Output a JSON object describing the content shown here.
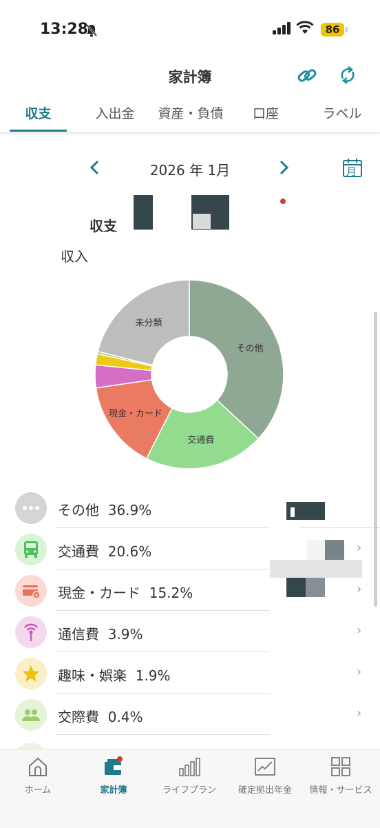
{
  "status_bar": {
    "time": "13:28",
    "battery": "86"
  },
  "header": {
    "title": "家計簿",
    "link_icon": "link-icon",
    "sync_icon": "sync-icon"
  },
  "tabs": [
    {
      "label": "収支",
      "active": true
    },
    {
      "label": "入出金",
      "active": false
    },
    {
      "label": "資産・負債",
      "active": false
    },
    {
      "label": "口座",
      "active": false,
      "badge": true
    },
    {
      "label": "ラベル",
      "active": false
    }
  ],
  "month_nav": {
    "label": "2026 年 1月",
    "calendar_label": "月"
  },
  "summary": {
    "title": "収支",
    "income_label": "収入"
  },
  "chart_data": {
    "type": "pie",
    "slices": [
      {
        "label": "その他",
        "value": 36.9,
        "color": "#8fa893"
      },
      {
        "label": "交通費",
        "value": 20.6,
        "color": "#93db8f"
      },
      {
        "label": "現金・カード",
        "value": 15.2,
        "color": "#ea7b62"
      },
      {
        "label": "",
        "value": 3.9,
        "color": "#d56ec4"
      },
      {
        "label": "",
        "value": 1.9,
        "color": "#efca14"
      },
      {
        "label": "",
        "value": 0.4,
        "color": "#a4cd72"
      },
      {
        "label": "未分類",
        "value": 21.1,
        "color": "#bdbdbd"
      }
    ],
    "donut": true
  },
  "categories": [
    {
      "label": "その他",
      "percent": "36.9%",
      "icon": "more-dots-icon",
      "bg": "#d4d4d4",
      "fg": "#ffffff"
    },
    {
      "label": "交通費",
      "percent": "20.6%",
      "icon": "bus-icon",
      "bg": "#d9f3d5",
      "fg": "#4cbf62"
    },
    {
      "label": "現金・カード",
      "percent": "15.2%",
      "icon": "card-icon",
      "bg": "#fadad2",
      "fg": "#e7705a"
    },
    {
      "label": "通信費",
      "percent": "3.9%",
      "icon": "antenna-icon",
      "bg": "#f4d9ee",
      "fg": "#c45bb3"
    },
    {
      "label": "趣味・娯楽",
      "percent": "1.9%",
      "icon": "star-icon",
      "bg": "#fbefc7",
      "fg": "#eebf0d"
    },
    {
      "label": "交際費",
      "percent": "0.4%",
      "icon": "people-icon",
      "bg": "#e7f3d6",
      "fg": "#9ccb6b"
    }
  ],
  "bottom_nav": [
    {
      "label": "ホーム",
      "icon": "home-icon",
      "active": false
    },
    {
      "label": "家計簿",
      "icon": "wallet-icon",
      "active": true
    },
    {
      "label": "ライフプラン",
      "icon": "bar-chart-icon",
      "active": false
    },
    {
      "label": "確定拠出年金",
      "icon": "line-chart-icon",
      "active": false
    },
    {
      "label": "情報・サービス",
      "icon": "grid-icon",
      "active": false
    }
  ]
}
